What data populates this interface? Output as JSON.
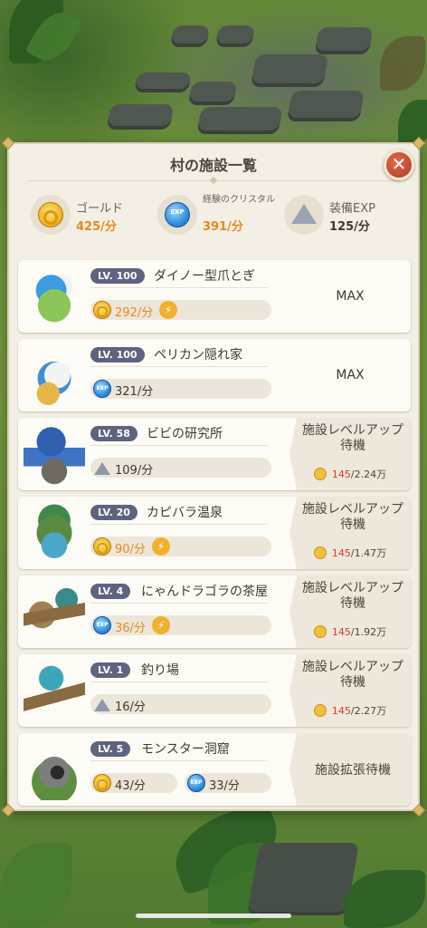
{
  "panel": {
    "title": "村の施設一覧",
    "close_icon": "close-icon"
  },
  "resources": [
    {
      "label": "ゴールド",
      "value": "425/分",
      "icon": "gold-coin-icon",
      "color": "#e58a1c"
    },
    {
      "label": "経験のクリスタル",
      "value": "391/分",
      "icon": "exp-crystal-icon",
      "color": "#e58a1c"
    },
    {
      "label": "装備EXP",
      "value": "125/分",
      "icon": "equipment-crystal-icon",
      "color": "#3f382e"
    }
  ],
  "facilities": [
    {
      "level": "LV. 100",
      "name": "ダイノー型爪とぎ",
      "rates": [
        {
          "icon": "gold-coin-icon",
          "value": "292/分",
          "boosted": true
        }
      ],
      "status": "MAX"
    },
    {
      "level": "LV. 100",
      "name": "ペリカン隠れ家",
      "rates": [
        {
          "icon": "exp-crystal-icon",
          "value": "321/分",
          "boosted": false
        }
      ],
      "status": "MAX"
    },
    {
      "level": "LV. 58",
      "name": "ビビの研究所",
      "rates": [
        {
          "icon": "equipment-crystal-icon",
          "value": "109/分",
          "boosted": false
        }
      ],
      "status": "施設レベルアップ待機",
      "cost_need": "145",
      "cost_have": "/2.24万"
    },
    {
      "level": "LV. 20",
      "name": "カピバラ温泉",
      "rates": [
        {
          "icon": "gold-coin-icon",
          "value": "90/分",
          "boosted": true
        }
      ],
      "status": "施設レベルアップ待機",
      "cost_need": "145",
      "cost_have": "/1.47万"
    },
    {
      "level": "LV. 4",
      "name": "にゃんドラゴラの茶屋",
      "rates": [
        {
          "icon": "exp-crystal-icon",
          "value": "36/分",
          "boosted": true
        }
      ],
      "status": "施設レベルアップ待機",
      "cost_need": "145",
      "cost_have": "/1.92万"
    },
    {
      "level": "LV. 1",
      "name": "釣り場",
      "rates": [
        {
          "icon": "equipment-crystal-icon",
          "value": "16/分",
          "boosted": false
        }
      ],
      "status": "施設レベルアップ待機",
      "cost_need": "145",
      "cost_have": "/2.27万"
    },
    {
      "level": "LV. 5",
      "name": "モンスター洞窟",
      "rates": [
        {
          "icon": "gold-coin-icon",
          "value": "43/分",
          "boosted": false
        },
        {
          "icon": "exp-crystal-icon",
          "value": "33/分",
          "boosted": false
        }
      ],
      "status": "施設拡張待機"
    }
  ],
  "colors": {
    "accent_orange": "#e58a1c",
    "cost_red": "#d83a2a",
    "level_badge": "#5d6380",
    "close_red": "#c24a2e"
  }
}
